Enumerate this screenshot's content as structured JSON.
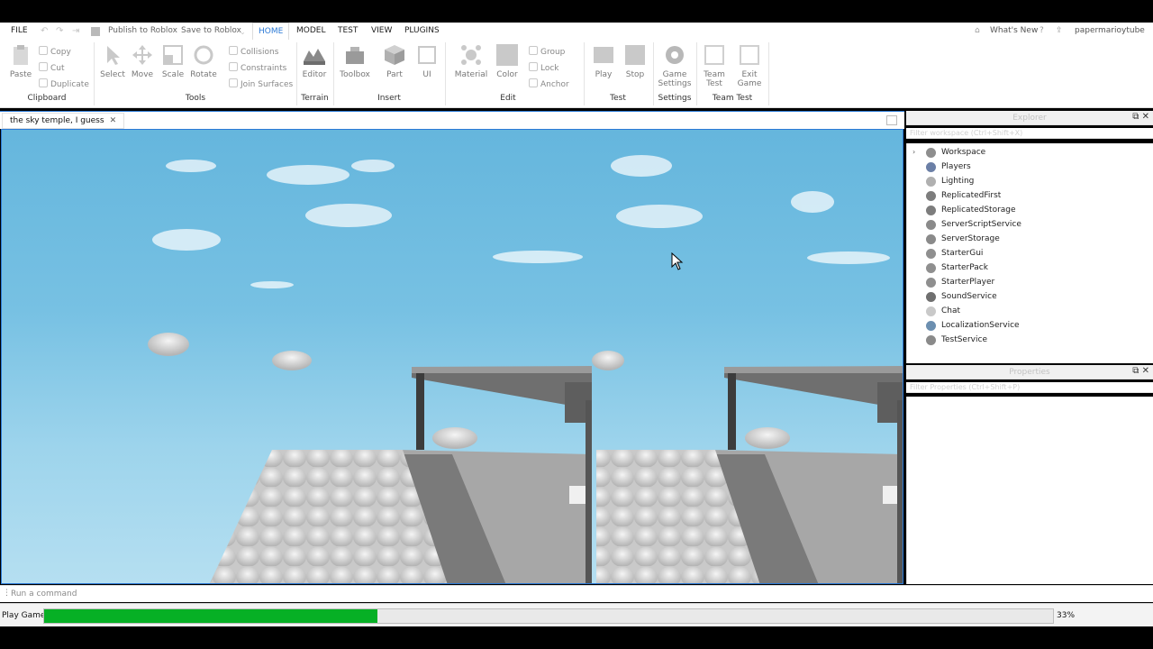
{
  "menubar": {
    "file": "FILE",
    "publish": "Publish to Roblox",
    "save": "Save to Roblox",
    "tabs": [
      "HOME",
      "MODEL",
      "TEST",
      "VIEW",
      "PLUGINS"
    ],
    "active_tab": "HOME",
    "whats_new": "What's New",
    "username": "papermarioytube"
  },
  "ribbon": {
    "clipboard": {
      "paste": "Paste",
      "copy": "Copy",
      "cut": "Cut",
      "duplicate": "Duplicate",
      "label": "Clipboard"
    },
    "tools": {
      "select": "Select",
      "move": "Move",
      "scale": "Scale",
      "rotate": "Rotate",
      "collisions": "Collisions",
      "constraints": "Constraints",
      "join_surfaces": "Join Surfaces",
      "label": "Tools"
    },
    "terrain": {
      "editor": "Editor",
      "label": "Terrain"
    },
    "insert": {
      "toolbox": "Toolbox",
      "part": "Part",
      "ui": "UI",
      "label": "Insert"
    },
    "edit": {
      "material": "Material",
      "color": "Color",
      "group": "Group",
      "lock": "Lock",
      "anchor": "Anchor",
      "label": "Edit"
    },
    "test": {
      "play": "Play",
      "stop": "Stop",
      "label": "Test"
    },
    "settings": {
      "game_settings_1": "Game",
      "game_settings_2": "Settings",
      "label": "Settings"
    },
    "team_test": {
      "team_test_1": "Team",
      "team_test_2": "Test",
      "exit_game_1": "Exit",
      "exit_game_2": "Game",
      "label": "Team Test"
    }
  },
  "document_tab": {
    "title": "the sky temple, I  guess"
  },
  "explorer": {
    "title": "Explorer",
    "filter_placeholder": "Filter workspace (Ctrl+Shift+X)",
    "items": [
      {
        "label": "Workspace",
        "icon": "workspace-icon",
        "color": "#8e8e8e"
      },
      {
        "label": "Players",
        "icon": "players-icon",
        "color": "#6b7fa6"
      },
      {
        "label": "Lighting",
        "icon": "lighting-icon",
        "color": "#b0b0b0"
      },
      {
        "label": "ReplicatedFirst",
        "icon": "replicated-first-icon",
        "color": "#7d7d7d"
      },
      {
        "label": "ReplicatedStorage",
        "icon": "replicated-storage-icon",
        "color": "#7d7d7d"
      },
      {
        "label": "ServerScriptService",
        "icon": "server-script-service-icon",
        "color": "#8a8a8a"
      },
      {
        "label": "ServerStorage",
        "icon": "server-storage-icon",
        "color": "#8a8a8a"
      },
      {
        "label": "StarterGui",
        "icon": "starter-gui-icon",
        "color": "#8f8f8f"
      },
      {
        "label": "StarterPack",
        "icon": "starter-pack-icon",
        "color": "#8f8f8f"
      },
      {
        "label": "StarterPlayer",
        "icon": "starter-player-icon",
        "color": "#8f8f8f"
      },
      {
        "label": "SoundService",
        "icon": "sound-service-icon",
        "color": "#6f6f6f"
      },
      {
        "label": "Chat",
        "icon": "chat-icon",
        "color": "#c9c9c9"
      },
      {
        "label": "LocalizationService",
        "icon": "localization-service-icon",
        "color": "#6c8fb0"
      },
      {
        "label": "TestService",
        "icon": "test-service-icon",
        "color": "#8a8a8a"
      }
    ]
  },
  "properties": {
    "title": "Properties",
    "filter_placeholder": "Filter Properties (Ctrl+Shift+P)"
  },
  "command_bar": {
    "placeholder": "Run a command"
  },
  "status": {
    "label": "Play Game",
    "progress_percent": 33,
    "progress_text": "33%",
    "progress_color": "#06b025"
  }
}
